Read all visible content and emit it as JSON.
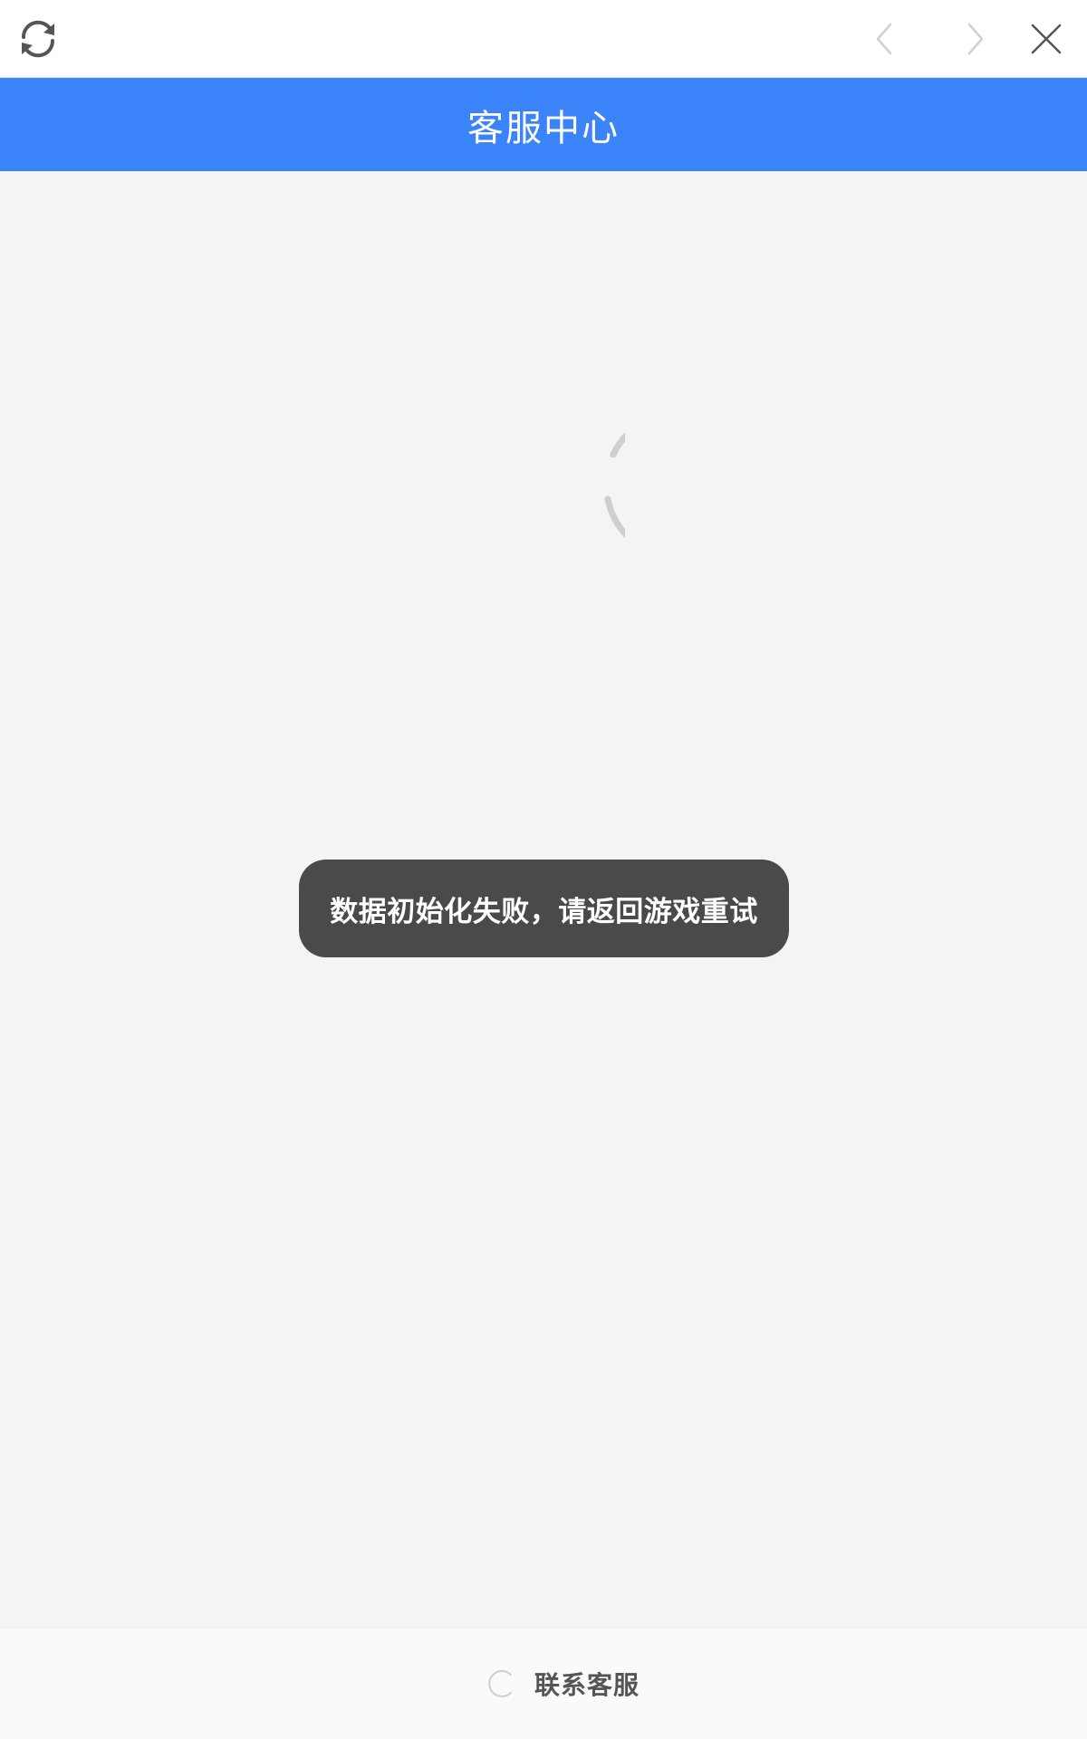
{
  "toolbar": {
    "refresh_icon": "refresh-icon",
    "back_icon": "chevron-left-icon",
    "forward_icon": "chevron-right-icon",
    "close_icon": "close-icon"
  },
  "header": {
    "title": "客服中心",
    "background": "#3a83f8"
  },
  "main": {
    "loading_icon": "loading-spinner-icon",
    "toast": {
      "message": "数据初始化失败，请返回游戏重试",
      "background": "#4a4a4a"
    }
  },
  "footer": {
    "contact_label": "联系客服",
    "contact_icon": "loading-spinner-icon"
  }
}
